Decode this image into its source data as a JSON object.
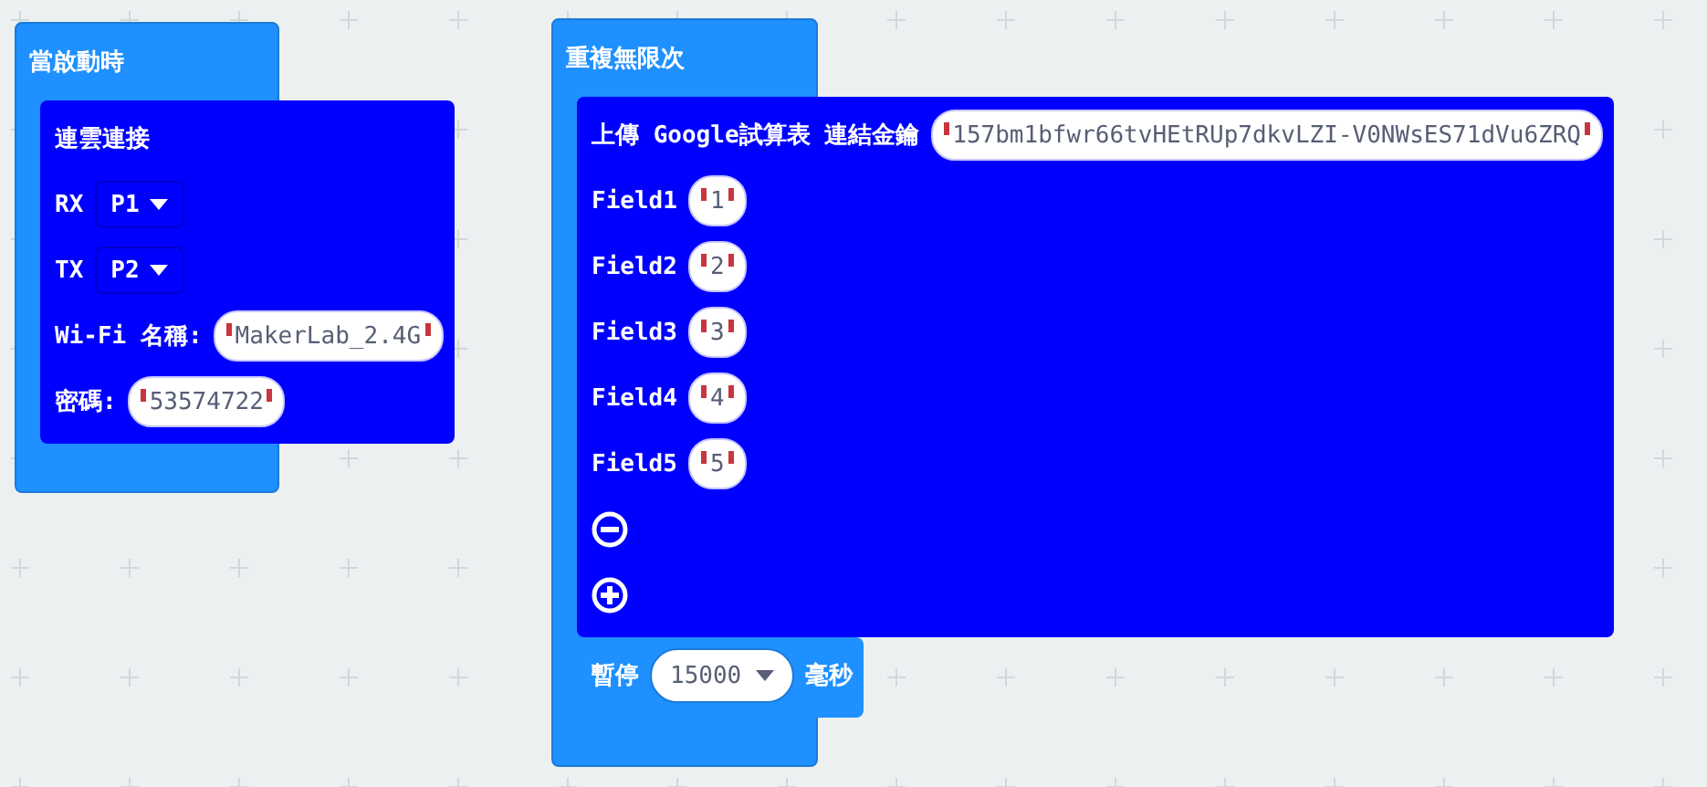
{
  "stacks": [
    {
      "header": "當啟動時",
      "blocks": [
        {
          "color": "#0000ff",
          "rows": [
            {
              "items": [
                {
                  "kind": "label",
                  "text": "連雲連接"
                }
              ]
            },
            {
              "items": [
                {
                  "kind": "label",
                  "text": "RX"
                },
                {
                  "kind": "dropdown",
                  "text": "P1"
                }
              ]
            },
            {
              "items": [
                {
                  "kind": "label",
                  "text": "TX"
                },
                {
                  "kind": "dropdown",
                  "text": "P2"
                }
              ]
            },
            {
              "items": [
                {
                  "kind": "label",
                  "text": "Wi-Fi 名稱:"
                },
                {
                  "kind": "string",
                  "text": "MakerLab_2.4G"
                }
              ]
            },
            {
              "items": [
                {
                  "kind": "label",
                  "text": "密碼:"
                },
                {
                  "kind": "string",
                  "text": "53574722"
                }
              ]
            }
          ]
        }
      ]
    },
    {
      "header": "重複無限次",
      "blocks": [
        {
          "color": "#0000ff",
          "rows": [
            {
              "items": [
                {
                  "kind": "label",
                  "text": "上傳 Google試算表 連結金鑰"
                },
                {
                  "kind": "string",
                  "text": "157bm1bfwr66tvHEtRUp7dkvLZI-V0NWsES71dVu6ZRQ"
                }
              ]
            },
            {
              "items": [
                {
                  "kind": "label",
                  "text": "Field1"
                },
                {
                  "kind": "string",
                  "text": "1"
                }
              ]
            },
            {
              "items": [
                {
                  "kind": "label",
                  "text": "Field2"
                },
                {
                  "kind": "string",
                  "text": "2"
                }
              ]
            },
            {
              "items": [
                {
                  "kind": "label",
                  "text": "Field3"
                },
                {
                  "kind": "string",
                  "text": "3"
                }
              ]
            },
            {
              "items": [
                {
                  "kind": "label",
                  "text": "Field4"
                },
                {
                  "kind": "string",
                  "text": "4"
                }
              ]
            },
            {
              "items": [
                {
                  "kind": "label",
                  "text": "Field5"
                },
                {
                  "kind": "string",
                  "text": "5"
                }
              ]
            },
            {
              "items": [
                {
                  "kind": "remove_button"
                }
              ]
            },
            {
              "items": [
                {
                  "kind": "add_button"
                }
              ]
            }
          ]
        },
        {
          "color": "#1e90ff",
          "rows": [
            {
              "items": [
                {
                  "kind": "label",
                  "text": "暫停"
                },
                {
                  "kind": "number_dropdown",
                  "text": "15000"
                },
                {
                  "kind": "label",
                  "text": "毫秒"
                }
              ]
            }
          ]
        }
      ]
    }
  ]
}
